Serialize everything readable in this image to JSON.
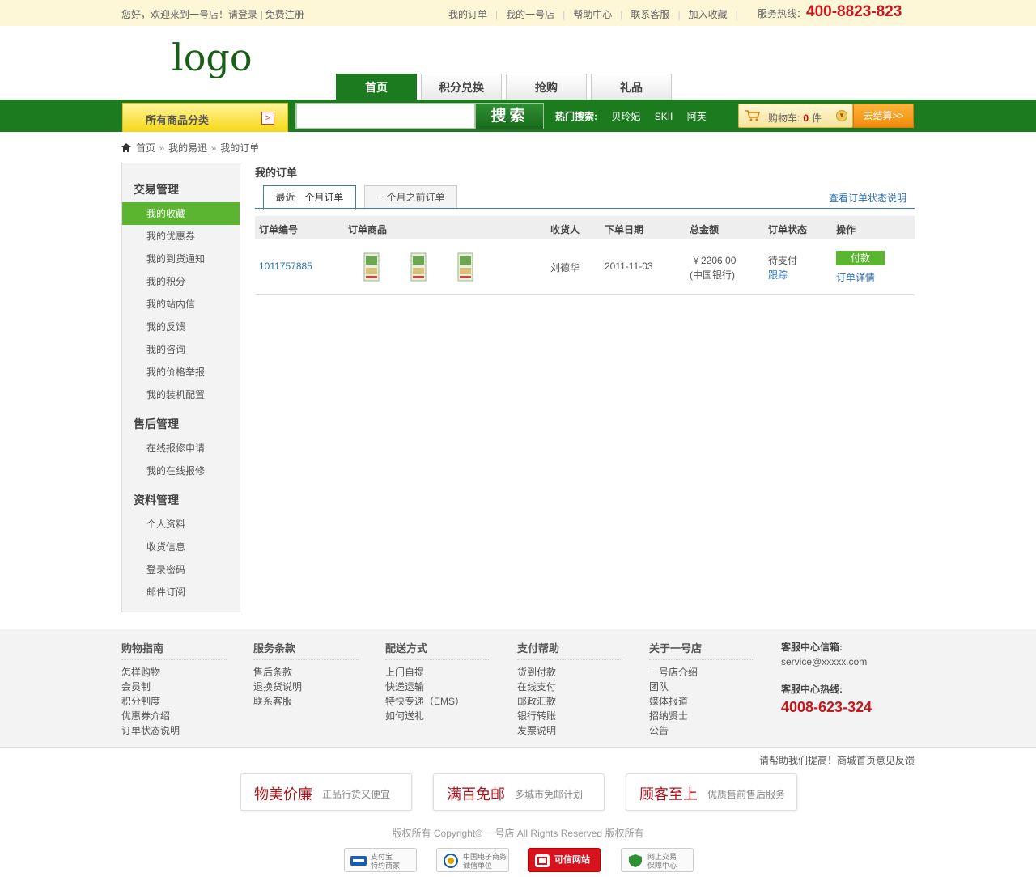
{
  "topbar": {
    "welcome": "您好，欢迎来到一号店！请登录 | 免费注册",
    "links": [
      "我的订单",
      "我的一号店",
      "帮助中心",
      "联系客服",
      "加入收藏"
    ],
    "hotline_label": "服务热线：",
    "hotline_number": "400-8823-823"
  },
  "header": {
    "logo": "logo",
    "nav": [
      "首页",
      "积分兑换",
      "抢购",
      "礼品"
    ]
  },
  "searchbar": {
    "category_label": "所有商品分类",
    "category_arrow": ">",
    "search_value": "",
    "search_button": "搜索",
    "hot_label": "热门搜索:",
    "hot_terms": [
      "贝玲妃",
      "SKII",
      "阿芙"
    ],
    "cart_label": "购物车:",
    "cart_count": "0",
    "cart_unit": "件",
    "cart_dropdown": "▼",
    "checkout": "去结算>>"
  },
  "breadcrumb": [
    "首页",
    "我的易迅",
    "我的订单"
  ],
  "sidebar": {
    "groups": [
      {
        "title": "交易管理",
        "items": [
          "我的收藏",
          "我的优惠券",
          "我的到货通知",
          "我的积分",
          "我的站内信",
          "我的反馈",
          "我的咨询",
          "我的价格举报",
          "我的装机配置"
        ]
      },
      {
        "title": "售后管理",
        "items": [
          "在线报修申请",
          "我的在线报修"
        ]
      },
      {
        "title": "资料管理",
        "items": [
          "个人资料",
          "收货信息",
          "登录密码",
          "邮件订阅"
        ]
      }
    ],
    "active_item": "我的收藏"
  },
  "main": {
    "title": "我的订单",
    "tabs": [
      "最近一个月订单",
      "一个月之前订单"
    ],
    "status_link": "查看订单状态说明",
    "columns": [
      "订单编号",
      "订单商品",
      "收货人",
      "下单日期",
      "总金额",
      "订单状态",
      "操作"
    ],
    "order": {
      "id": "1011757885",
      "receiver": "刘德华",
      "date": "2011-11-03",
      "amount": "￥2206.00",
      "payment": "(中国银行)",
      "status": "待支付",
      "track": "跟踪",
      "pay_button": "付款",
      "detail_link": "订单详情"
    }
  },
  "footer": {
    "columns": [
      {
        "title": "购物指南",
        "items": [
          "怎样购物",
          "会员制",
          "积分制度",
          "优惠券介绍",
          "订单状态说明"
        ]
      },
      {
        "title": "服务条款",
        "items": [
          "售后条款",
          "退换货说明",
          "联系客服"
        ]
      },
      {
        "title": "配送方式",
        "items": [
          "上门自提",
          "快递运输",
          "特快专递（EMS）",
          "如何送礼"
        ]
      },
      {
        "title": "支付帮助",
        "items": [
          "货到付款",
          "在线支付",
          "邮政汇款",
          "银行转账",
          "发票说明"
        ]
      },
      {
        "title": "关于一号店",
        "items": [
          "一号店介绍",
          "团队",
          "媒体报道",
          "招纳贤士",
          "公告"
        ]
      }
    ],
    "contact_email_label": "客服中心信箱:",
    "contact_email": "service@xxxxx.com",
    "contact_phone_label": "客服中心热线:",
    "contact_phone": "4008-623-324",
    "feedback": "请帮助我们提高！商城首页意见反馈",
    "promos": [
      {
        "main": "物美价廉",
        "sub": "正品行货又便宜"
      },
      {
        "main": "满百免邮",
        "sub": "多城市免邮计划"
      },
      {
        "main": "顾客至上",
        "sub": "优质售前售后服务"
      }
    ],
    "copyright": "版权所有 Copyright© 一号店 All Rights Reserved 版权所有",
    "badges": [
      {
        "l1": "支付宝",
        "l2": "特约商家"
      },
      {
        "l1": "中国电子商务",
        "l2": "诚信单位"
      },
      {
        "l1": "可信网站",
        "l2": ""
      },
      {
        "l1": "网上交易",
        "l2": "保障中心"
      }
    ]
  },
  "colors": {
    "brand_green": "#1c7a1f",
    "accent_green": "#5bb531",
    "hotline_red": "#c8161d",
    "link_blue": "#2a6db3"
  }
}
